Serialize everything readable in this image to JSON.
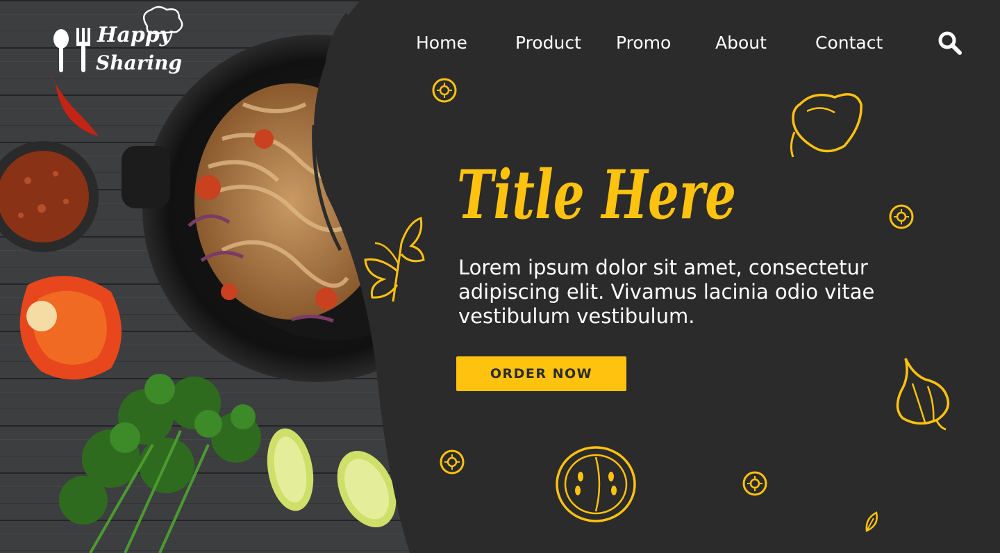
{
  "brand": {
    "name_line1": "Happy",
    "name_line2": "Sharing"
  },
  "nav": {
    "items": [
      "Home",
      "Product",
      "Promo",
      "About",
      "Contact"
    ]
  },
  "hero": {
    "title": "Title Here",
    "description": "Lorem ipsum dolor sit amet, consectetur adipiscing elit. Vivamus lacinia odio vitae vestibulum vestibulum.",
    "cta_label": "ORDER NOW"
  },
  "icons": {
    "search": "search-icon",
    "logo": "fork-spoon-chef-hat-icon",
    "doodles": [
      "sun-seed-icon",
      "pepper-doodle-icon",
      "parsley-doodle-icon",
      "garlic-doodle-icon",
      "tomato-slice-doodle-icon",
      "leaf-doodle-icon"
    ]
  },
  "colors": {
    "panel": "#2b2b2b",
    "accent": "#ffc20e",
    "text": "#ffffff",
    "button_text": "#2b2b2b"
  }
}
